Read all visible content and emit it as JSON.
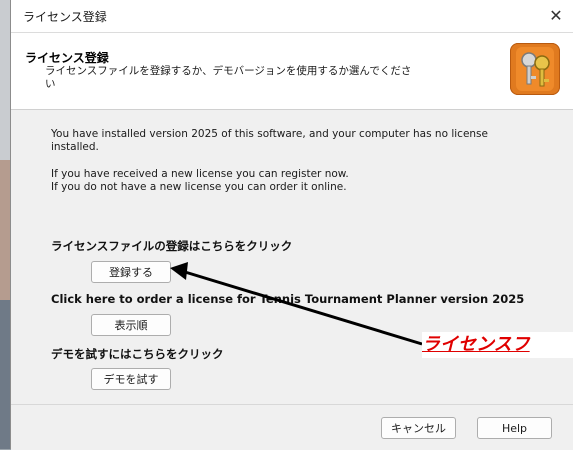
{
  "window": {
    "title": "ライセンス登録",
    "close_glyph": "✕"
  },
  "header": {
    "title": "ライセンス登録",
    "subtitle": "ライセンスファイルを登録するか、デモバージョンを使用するか選んでください",
    "icon": "keys-icon"
  },
  "info": {
    "line1": "You have installed version 2025 of this software, and your computer has no license",
    "line2": "installed.",
    "line3": "If you have received a new license you can register now.",
    "line4": "If you do not have a new license you can order it online."
  },
  "sections": {
    "register_label": "ライセンスファイルの登録はこちらをクリック",
    "register_button": "登録する",
    "order_label": "Click here to order a license for Tennis Tournament Planner version 2025",
    "order_button": "表示順",
    "demo_label": "デモを試すにはこちらをクリック",
    "demo_button": "デモを試す"
  },
  "footer": {
    "cancel_label": "キャンセル",
    "help_label": "Help"
  },
  "annotation": {
    "callout_text": "ライセンスフ",
    "color": "#e00000"
  }
}
